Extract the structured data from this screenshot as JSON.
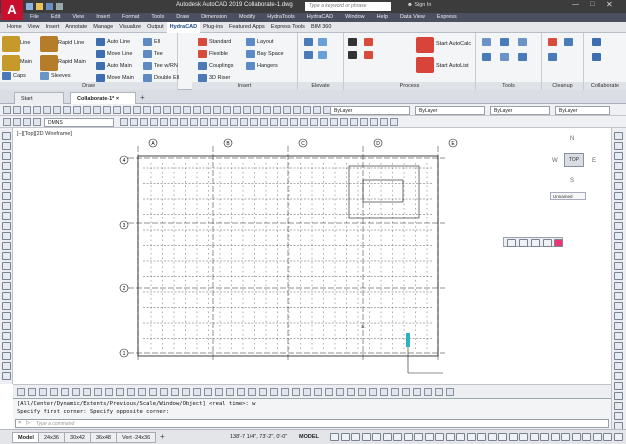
{
  "app": {
    "logo": "A",
    "title": "Autodesk AutoCAD 2019    Collaborate-1.dwg",
    "search_placeholder": "Type a keyword or phrase",
    "sign_in": "Sign In"
  },
  "menu": [
    "File",
    "Edit",
    "View",
    "Insert",
    "Format",
    "Tools",
    "Draw",
    "Dimension",
    "Modify",
    "HydraTools",
    "HydraCAD",
    "Window",
    "Help",
    "Data View",
    "Express"
  ],
  "ribbon_tabs": [
    "Home",
    "View",
    "Insert",
    "Annotate",
    "Manage",
    "Visualize",
    "Output",
    "HydraCAD",
    "Plug-ins",
    "Featured Apps",
    "Express Tools",
    "BIM 360"
  ],
  "ribbon_active": "HydraCAD",
  "panels": {
    "draw": {
      "label": "Draw",
      "items": [
        "Line",
        "Rapid Line",
        "Auto Line",
        "Ell",
        "Main",
        "Rapid Main",
        "Move Line",
        "Tee",
        "Auto Main",
        "Tee w/RN",
        "Caps",
        "Sleeves",
        "Move Main",
        "Double Ell"
      ]
    },
    "insert": {
      "label": "Insert",
      "items": [
        "Standard",
        "Layout",
        "Flexible",
        "Bay Space",
        "Couplings",
        "Hangers",
        "3D Riser"
      ]
    },
    "elevate": {
      "label": "Elevate"
    },
    "process": {
      "label": "Process",
      "items": [
        "Start AutoCalc",
        "Start AutoList"
      ]
    },
    "tools": {
      "label": "Tools"
    },
    "cleanup": {
      "label": "Cleanup"
    },
    "collaborate": {
      "label": "Collaborate"
    }
  },
  "doc_tabs": [
    "Start",
    "Collaborate-1*"
  ],
  "toolbar": {
    "layer_combo": "DMNS",
    "color_combo": "ByLayer",
    "linetype_combo": "ByLayer",
    "lineweight_combo": "ByLayer",
    "plot_combo": "ByLayer"
  },
  "viewport_label": "[–][Top][2D Wireframe]",
  "viewcube": {
    "n": "N",
    "s": "S",
    "e": "E",
    "w": "W",
    "top": "TOP",
    "ucs": "Unnamed"
  },
  "grid": {
    "cols": [
      "A",
      "B",
      "C",
      "D",
      "E"
    ],
    "rows": [
      "4",
      "3",
      "2",
      "1"
    ],
    "dim_label": "3/-"
  },
  "command": {
    "line1": "[All/Center/Dynamic/Extents/Previous/Scale/Window/Object] <real time>: w",
    "line2": "Specify first corner: Specify opposite corner:",
    "placeholder": "Type a command"
  },
  "layout_tabs": [
    "Model",
    "24x36",
    "30x42",
    "36x48",
    "Vert -24x36"
  ],
  "status": {
    "coords": "138'-7 1/4\", 73'-2\", 0'-0\"",
    "space": "MODEL"
  },
  "colors": {
    "accent": "#c8102e",
    "titlebar": "#3c3c3c",
    "active_tab": "#1a4a8a"
  }
}
